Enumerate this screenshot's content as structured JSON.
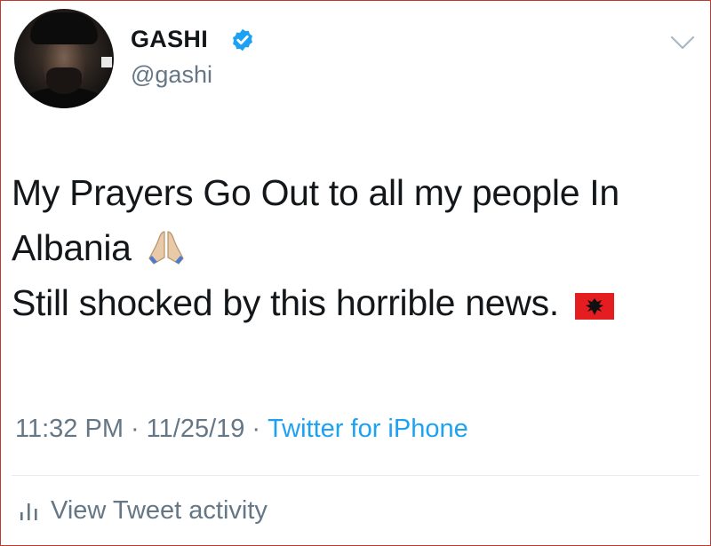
{
  "user": {
    "display_name": "GASHI",
    "handle": "@gashi",
    "verified": true
  },
  "tweet": {
    "lines": [
      "My Prayers Go Out to all my people In",
      "Albania",
      "Still shocked by this horrible news."
    ],
    "emojis": [
      "folded-hands-icon",
      "albania-flag-icon"
    ]
  },
  "meta": {
    "time": "11:32 PM",
    "date": "11/25/19",
    "separator": "·",
    "source": "Twitter for iPhone"
  },
  "activity": {
    "label": "View Tweet activity"
  },
  "colors": {
    "text": "#14171a",
    "secondary": "#657786",
    "link": "#1da1f2",
    "verified": "#1da1f2"
  }
}
